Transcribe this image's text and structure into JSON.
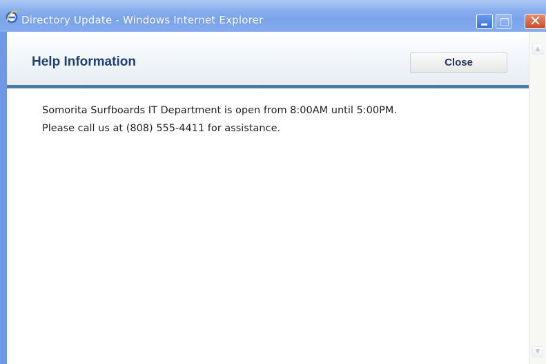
{
  "window": {
    "title": "Directory Update - Windows Internet Explorer",
    "icon": "internet-explorer-icon",
    "controls": {
      "minimize": "minimize-icon",
      "maximize": "maximize-icon",
      "close": "✕"
    }
  },
  "header": {
    "title": "Help Information",
    "close_label": "Close"
  },
  "message": {
    "line1": "Somorita Surfboards IT Department is open from 8:00AM until 5:00PM.",
    "line2": "Please call us at (808) 555-4411 for assistance."
  },
  "scrollbar": {
    "up_glyph": "▲",
    "down_glyph": "▼"
  },
  "colors": {
    "title_bar": "#7aa3ea",
    "header_title": "#1d3f73",
    "header_rule": "#4b7aa6",
    "close_window_button": "#c84d2b"
  }
}
